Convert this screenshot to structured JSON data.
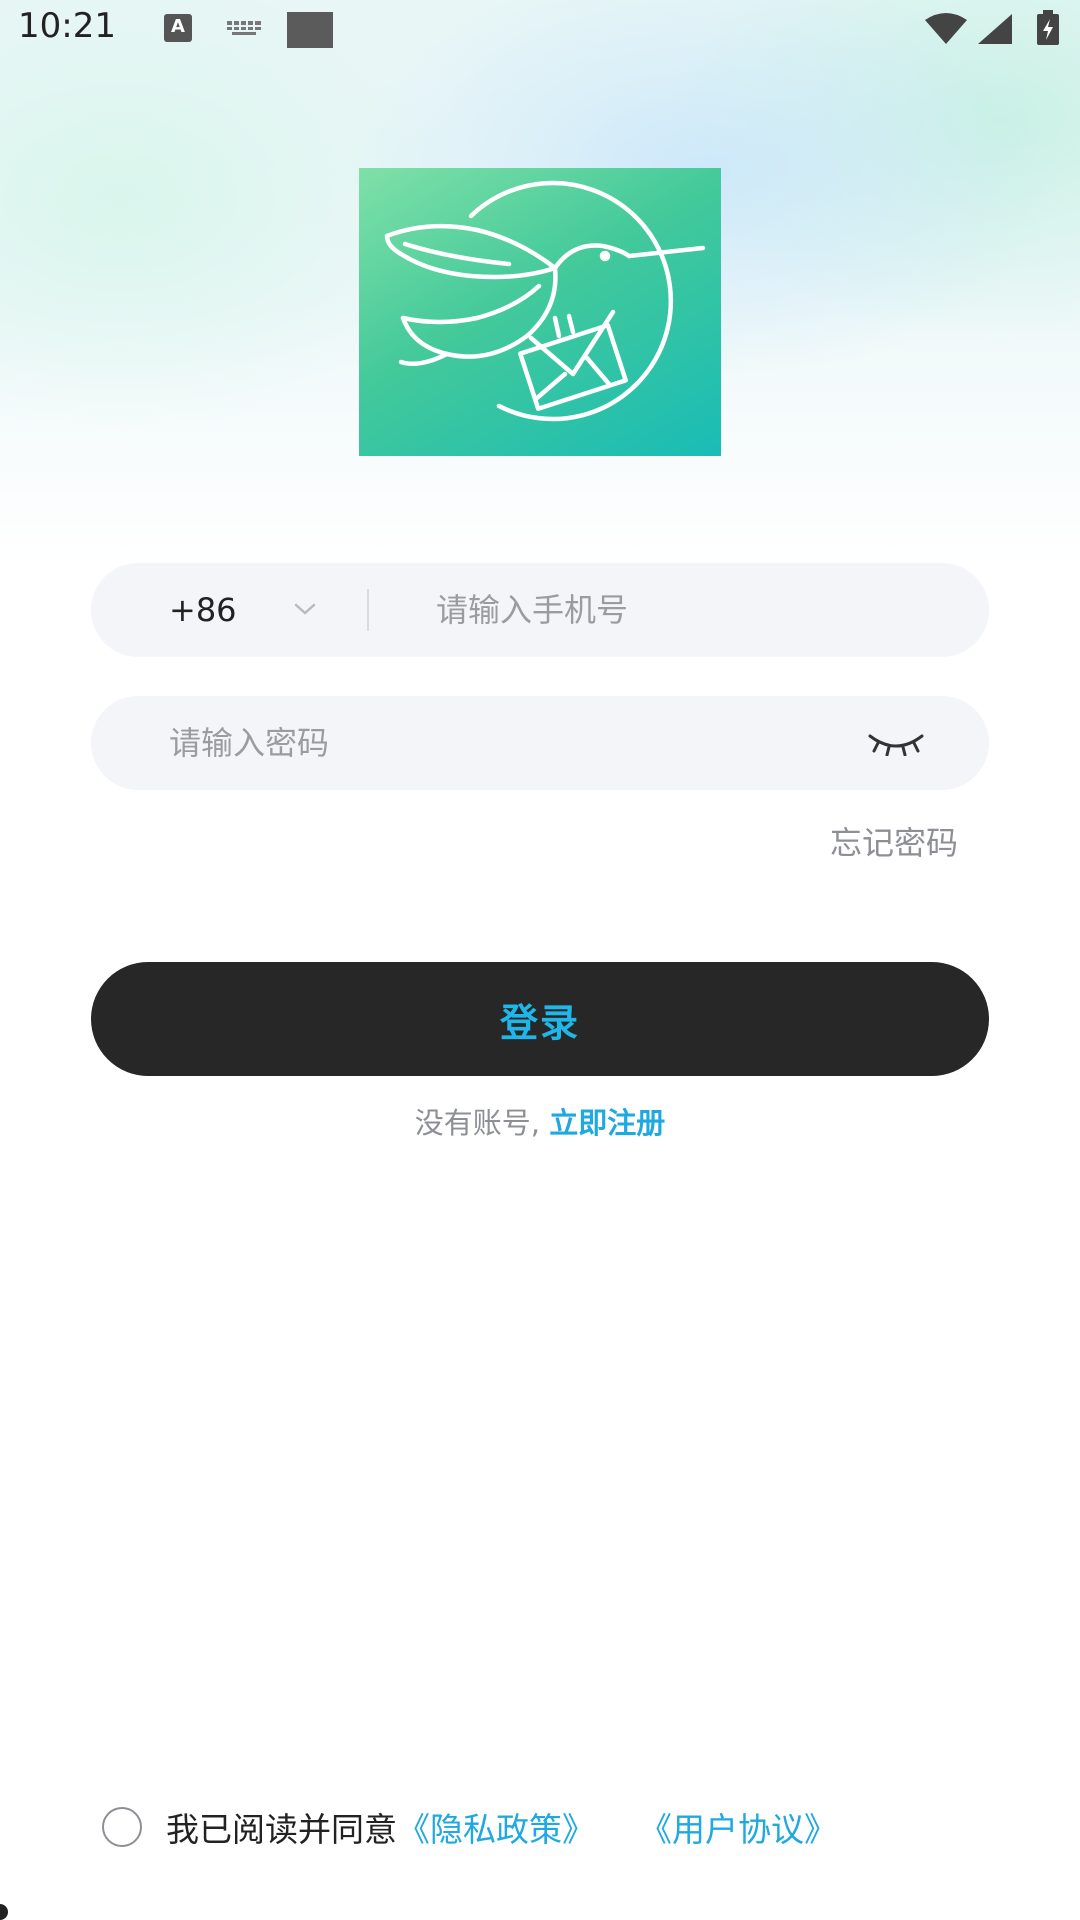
{
  "status_bar": {
    "time": "10:21",
    "icons": [
      "text-a-icon",
      "keyboard-icon",
      "square-icon",
      "wifi-icon",
      "signal-icon",
      "battery-charging-icon"
    ],
    "a_label": "A"
  },
  "logo": {
    "icon": "hummingbird-envelope-icon",
    "gradient": [
      "#7fe0a8",
      "#19bcb6"
    ]
  },
  "phone": {
    "country_code": "+86",
    "placeholder": "请输入手机号",
    "value": ""
  },
  "password": {
    "placeholder": "请输入密码",
    "value": "",
    "toggle_icon": "eye-closed-icon"
  },
  "forgot_password": "忘记密码",
  "login_button": "登录",
  "register": {
    "prompt": "没有账号,",
    "link": "立即注册"
  },
  "agreement": {
    "text": "我已阅读并同意",
    "privacy_policy": "《隐私政策》",
    "user_agreement": "《用户协议》",
    "checked": false
  },
  "colors": {
    "accent": "#1fa9e0",
    "button_bg": "#272727",
    "button_text": "#1fb7ea",
    "input_bg": "#f3f5f9"
  }
}
